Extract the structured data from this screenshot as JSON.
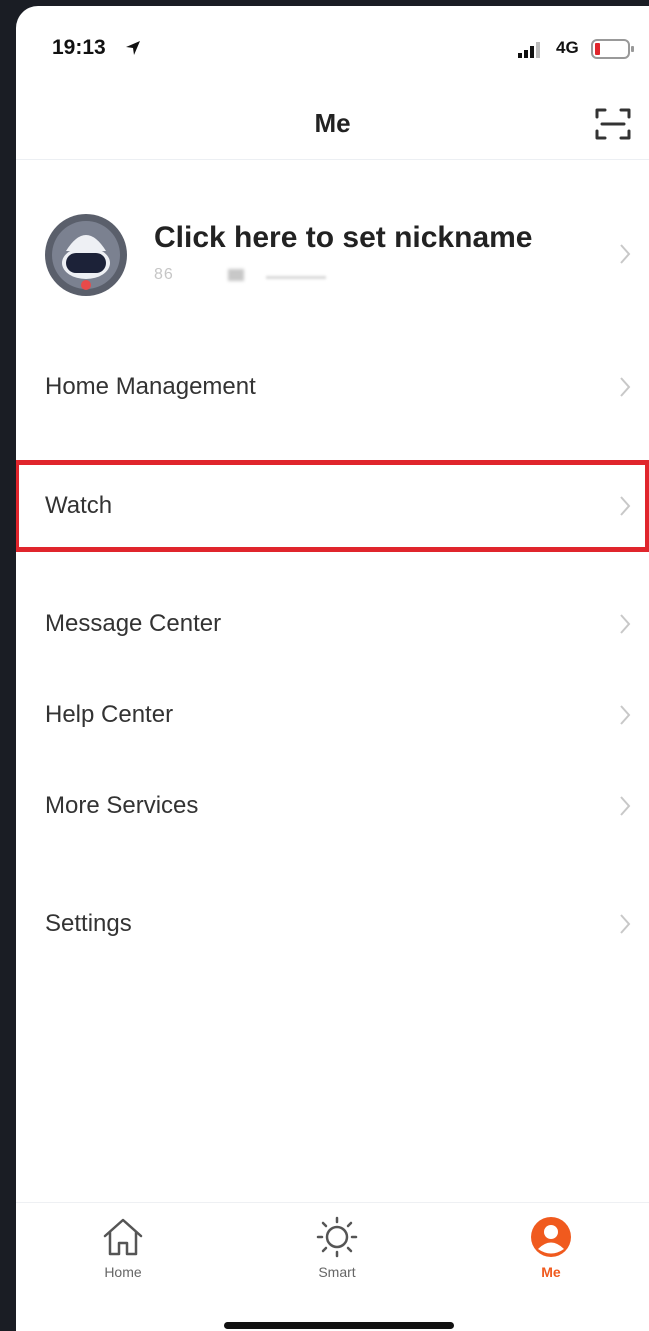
{
  "status_bar": {
    "time": "19:13",
    "network": "4G"
  },
  "header": {
    "title": "Me"
  },
  "profile": {
    "nickname": "Click here to set nickname",
    "account_prefix": "86"
  },
  "menu": {
    "items": [
      {
        "label": "Home Management"
      },
      {
        "label": "Watch"
      },
      {
        "label": "Message Center"
      },
      {
        "label": "Help Center"
      },
      {
        "label": "More Services"
      },
      {
        "label": "Settings"
      }
    ]
  },
  "tab_bar": {
    "tabs": [
      {
        "label": "Home",
        "icon": "home-icon"
      },
      {
        "label": "Smart",
        "icon": "sun-icon"
      },
      {
        "label": "Me",
        "icon": "person-icon",
        "active": true
      }
    ]
  },
  "colors": {
    "accent": "#f05a1e",
    "highlight": "#e0252c"
  }
}
